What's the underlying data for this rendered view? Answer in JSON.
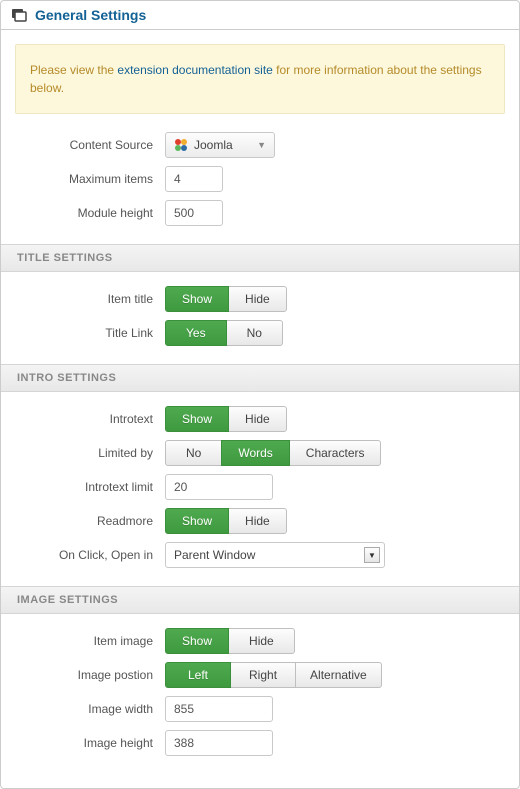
{
  "header": {
    "title": "General Settings"
  },
  "notice": {
    "lead": "Please view the ",
    "link": "extension documentation site",
    "tail": " for more information about the settings below."
  },
  "general": {
    "content_source_label": "Content Source",
    "content_source_value": "Joomla",
    "max_items_label": "Maximum items",
    "max_items_value": "4",
    "module_height_label": "Module height",
    "module_height_value": "500"
  },
  "title_section": {
    "heading": "TITLE SETTINGS",
    "item_title_label": "Item title",
    "item_title_show": "Show",
    "item_title_hide": "Hide",
    "title_link_label": "Title Link",
    "title_link_yes": "Yes",
    "title_link_no": "No"
  },
  "intro_section": {
    "heading": "INTRO SETTINGS",
    "introtext_label": "Introtext",
    "introtext_show": "Show",
    "introtext_hide": "Hide",
    "limited_by_label": "Limited by",
    "limited_no": "No",
    "limited_words": "Words",
    "limited_chars": "Characters",
    "introtext_limit_label": "Introtext limit",
    "introtext_limit_value": "20",
    "readmore_label": "Readmore",
    "readmore_show": "Show",
    "readmore_hide": "Hide",
    "on_click_label": "On Click, Open in",
    "on_click_value": "Parent Window"
  },
  "image_section": {
    "heading": "IMAGE SETTINGS",
    "item_image_label": "Item image",
    "item_image_show": "Show",
    "item_image_hide": "Hide",
    "image_position_label": "Image postion",
    "pos_left": "Left",
    "pos_right": "Right",
    "pos_alt": "Alternative",
    "image_width_label": "Image width",
    "image_width_value": "855",
    "image_height_label": "Image height",
    "image_height_value": "388"
  }
}
